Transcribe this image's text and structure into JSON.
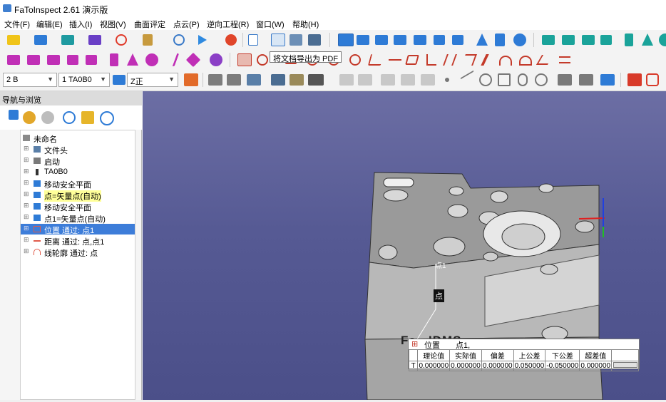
{
  "app": {
    "title": "FaToInspect 2.61 演示版",
    "accent_color": "#3d7dd9"
  },
  "menu": [
    "文件(F)",
    "编辑(E)",
    "插入(I)",
    "视图(V)",
    "曲面评定",
    "点云(P)",
    "逆向工程(R)",
    "窗口(W)",
    "帮助(H)"
  ],
  "toolbar3": {
    "combo1": "2 B",
    "combo2": "1 TA0B0",
    "combo3": "Z正"
  },
  "tooltip": "将文档导出为 PDF",
  "nav": {
    "title": "导航与浏览",
    "tree": [
      {
        "label": "未命名",
        "icon": "document-icon"
      },
      {
        "label": "文件头",
        "icon": "file-header-icon"
      },
      {
        "label": "启动",
        "icon": "start-icon"
      },
      {
        "label": "TA0B0",
        "icon": "probe-icon"
      },
      {
        "label": "移动安全平面",
        "icon": "safe-plane-icon"
      },
      {
        "label": "点=矢量点(自动)",
        "icon": "vector-point-icon"
      },
      {
        "label": "移动安全平面",
        "icon": "safe-plane-icon"
      },
      {
        "label": "点1=矢量点(自动)",
        "icon": "vector-point-icon"
      },
      {
        "label": "位置 通过: 点1",
        "icon": "position-icon"
      },
      {
        "label": "距离 通过: 点,点1",
        "icon": "distance-icon"
      },
      {
        "label": "线轮廓 通过: 点",
        "icon": "line-profile-icon"
      }
    ]
  },
  "viewport": {
    "point_label_1": "点1",
    "point_label_2": "点",
    "part_text": "Fa.. IDMS"
  },
  "result": {
    "title": "位置",
    "feature": "点1,",
    "headers": [
      "理论值",
      "实际值",
      "偏差",
      "上公差",
      "下公差",
      "超差值"
    ],
    "row_label": "T",
    "values": [
      "0.000000",
      "0.000000",
      "0.000000",
      "0.050000",
      "-0.050000",
      "0.000000"
    ]
  }
}
